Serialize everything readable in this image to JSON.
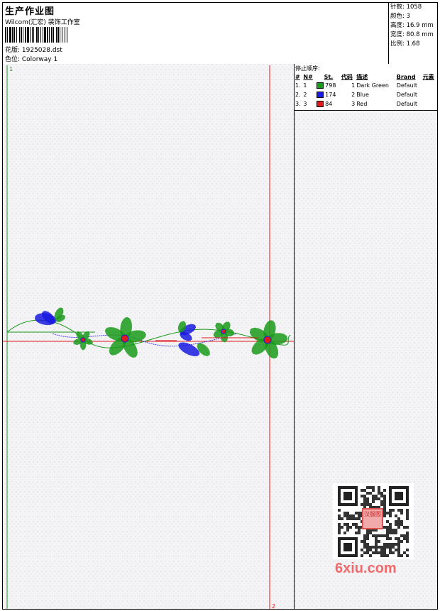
{
  "header": {
    "title": "生产作业图",
    "company": "Wilcom(汇宏) 装饰工作室",
    "file": "花版: 1925028.dst",
    "colorway": "色位: Colorway 1"
  },
  "stats": {
    "stitches": "针数: 1058",
    "colors": "颜色: 3",
    "height": "高度: 16.9 mm",
    "width": "宽度: 80.8 mm",
    "scale": "比例: 1.68"
  },
  "stop_sequence": {
    "title": "停止顺序:",
    "headers": [
      "#",
      "N#",
      "St.",
      "代码",
      "描述",
      "Brand",
      "元素"
    ],
    "rows": [
      {
        "idx": "1.",
        "n": "1",
        "color": "#1a9a1a",
        "st": "798",
        "code": "1",
        "desc": "Dark Green",
        "brand": "Default"
      },
      {
        "idx": "2.",
        "n": "2",
        "color": "#1a1ae0",
        "st": "174",
        "code": "2",
        "desc": "Blue",
        "brand": "Default"
      },
      {
        "idx": "3.",
        "n": "3",
        "color": "#e01a1a",
        "st": "84",
        "code": "3",
        "desc": "Red",
        "brand": "Default"
      }
    ]
  },
  "canvas": {
    "marker_start": "1",
    "marker_end": "2"
  },
  "colors": {
    "green": "#1a9a1a",
    "blue": "#1a1ae0",
    "red": "#e01a1a"
  },
  "watermark": "6xiu.com",
  "qr_badge": "汉服图"
}
